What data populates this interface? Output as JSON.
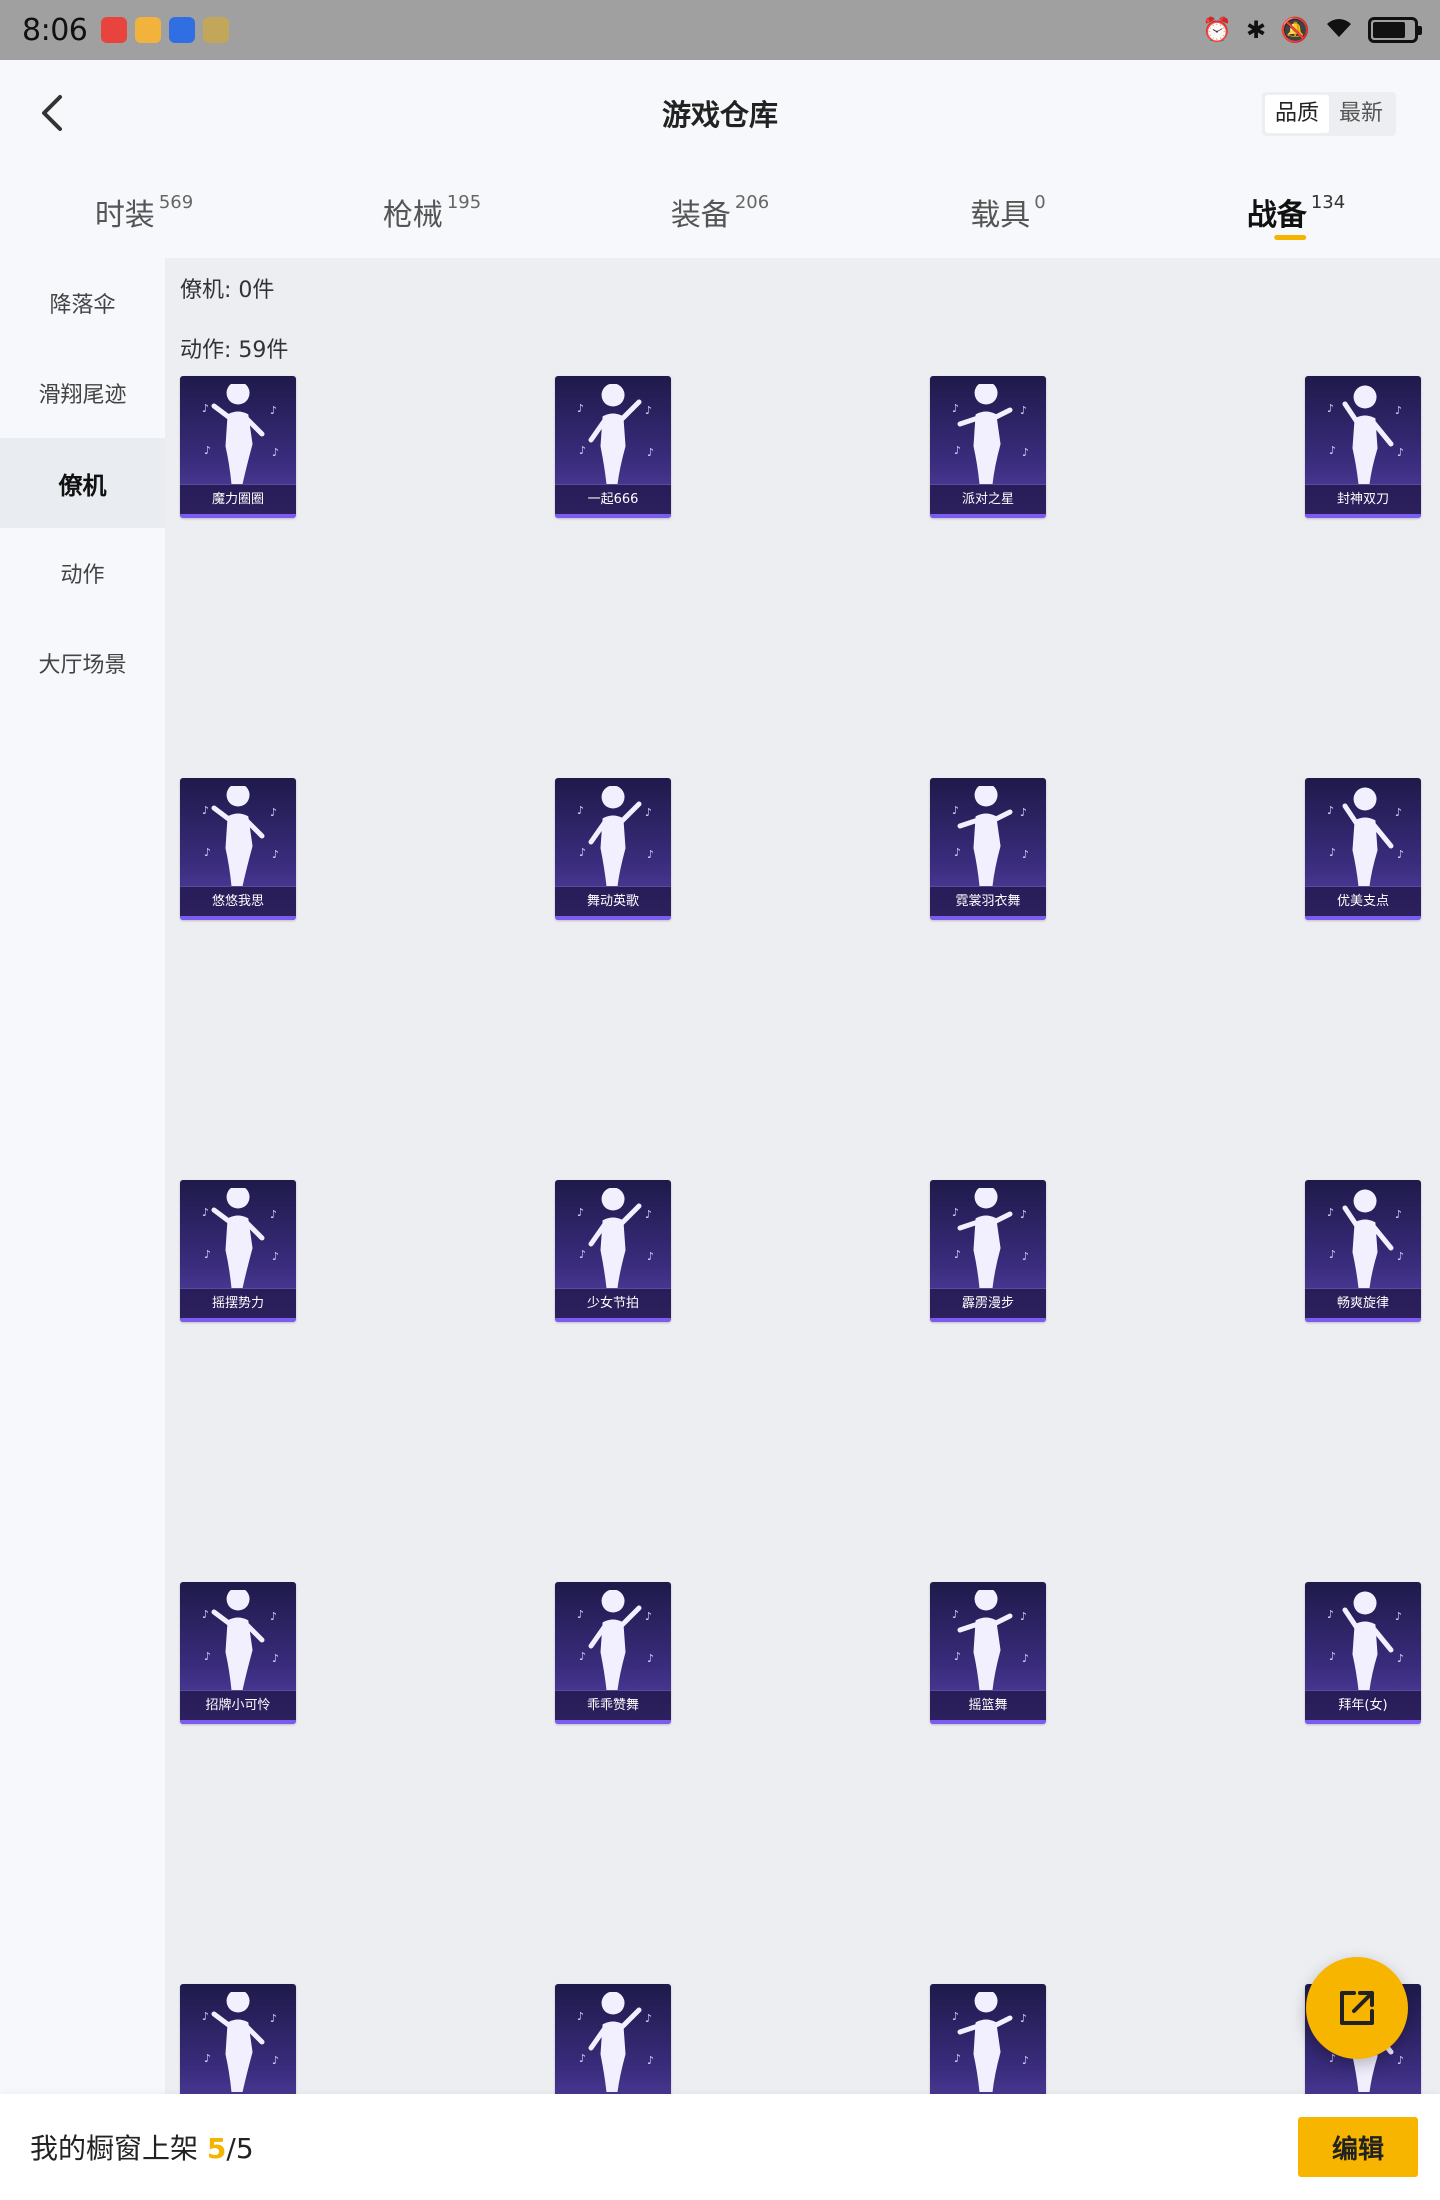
{
  "status_bar": {
    "time": "8:06",
    "app_colors": [
      "#e8433c",
      "#f2b33d",
      "#2f6fe3",
      "#c2a75a"
    ]
  },
  "header": {
    "title": "游戏仓库",
    "sort": {
      "quality": "品质",
      "latest": "最新"
    }
  },
  "tabs": [
    {
      "label": "时装",
      "count": "569"
    },
    {
      "label": "枪械",
      "count": "195"
    },
    {
      "label": "装备",
      "count": "206"
    },
    {
      "label": "载具",
      "count": "0"
    },
    {
      "label": "战备",
      "count": "134"
    }
  ],
  "sidebar": {
    "items": [
      "降落伞",
      "滑翔尾迹",
      "僚机",
      "动作",
      "大厅场景"
    ]
  },
  "sections": {
    "wingman": "僚机: 0件",
    "actions": "动作: 59件"
  },
  "items": [
    {
      "name": "魔力圈圈"
    },
    {
      "name": "一起666"
    },
    {
      "name": "派对之星"
    },
    {
      "name": "封神双刀"
    },
    {
      "name": "悠悠我思"
    },
    {
      "name": "舞动英歌"
    },
    {
      "name": "霓裳羽衣舞"
    },
    {
      "name": "优美支点"
    },
    {
      "name": "摇摆势力"
    },
    {
      "name": "少女节拍"
    },
    {
      "name": "霹雳漫步"
    },
    {
      "name": "畅爽旋律"
    },
    {
      "name": "招牌小可怜"
    },
    {
      "name": "乖乖赞舞"
    },
    {
      "name": "摇篮舞"
    },
    {
      "name": "拜年(女)"
    },
    {
      "name": ""
    },
    {
      "name": ""
    },
    {
      "name": ""
    },
    {
      "name": ""
    }
  ],
  "bottom_bar": {
    "showcase_prefix": "我的橱窗上架 ",
    "showcase_count": "5",
    "showcase_total": "/5",
    "edit_label": "编辑"
  },
  "colors": {
    "accent": "#f7b500",
    "card_top": "#1e1a4a",
    "card_bottom": "#5a44a8"
  }
}
